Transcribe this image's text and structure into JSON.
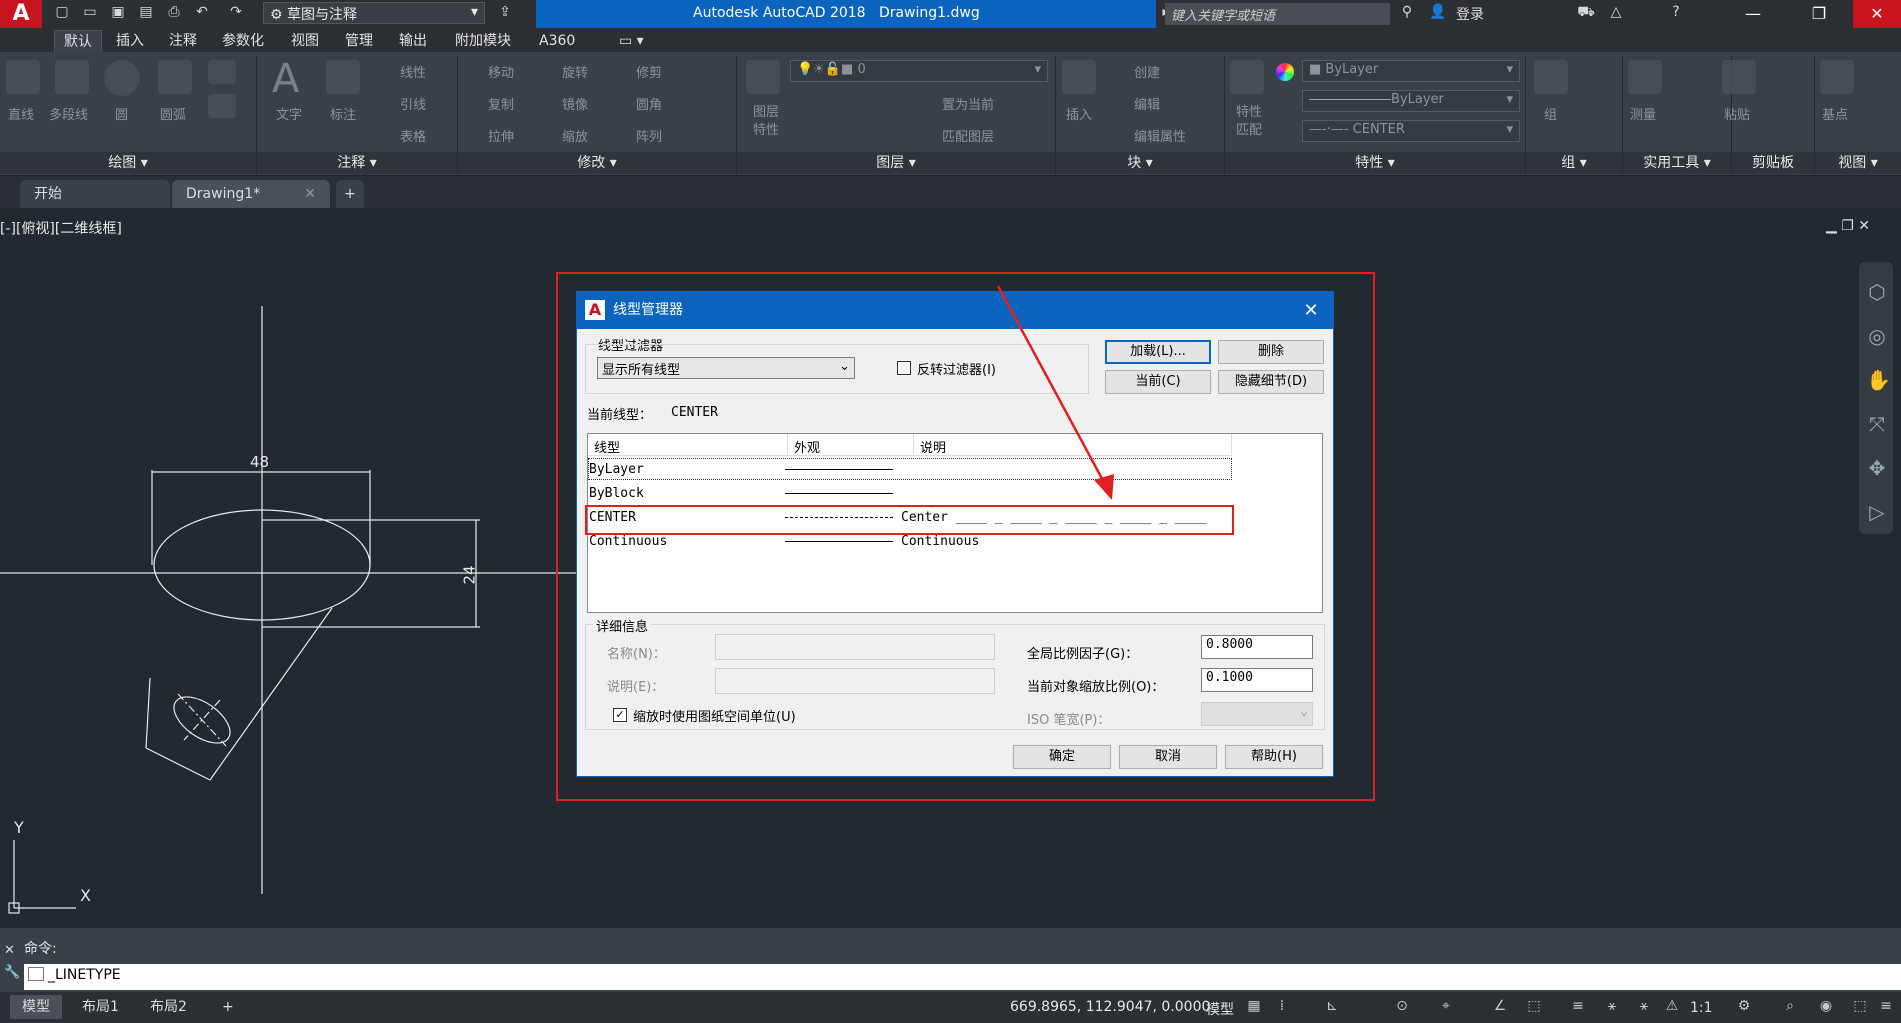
{
  "app": {
    "logo": "A",
    "title": "Autodesk AutoCAD 2018",
    "doc_name": "Drawing1.dwg",
    "workspace": "草图与注释",
    "search_placeholder": "键入关键字或短语",
    "login": "登录"
  },
  "menu_tabs": [
    "默认",
    "插入",
    "注释",
    "参数化",
    "视图",
    "管理",
    "输出",
    "附加模块",
    "A360"
  ],
  "ribbon": {
    "draw": {
      "title": "绘图",
      "items": [
        "直线",
        "多段线",
        "圆",
        "圆弧"
      ]
    },
    "annotate": {
      "title": "注释",
      "items": [
        "文字",
        "标注",
        "线性",
        "引线",
        "表格"
      ]
    },
    "modify": {
      "title": "修改",
      "items": [
        "移动",
        "旋转",
        "修剪",
        "复制",
        "镜像",
        "圆角",
        "拉伸",
        "缩放",
        "阵列"
      ]
    },
    "layers": {
      "title": "图层",
      "items": [
        "图层特性",
        "置为当前",
        "匹配图层"
      ],
      "layer_value": "0"
    },
    "block": {
      "title": "块",
      "items": [
        "插入",
        "创建",
        "编辑",
        "编辑属性"
      ]
    },
    "properties": {
      "title": "特性",
      "items": [
        "特性匹配"
      ],
      "color": "ByLayer",
      "lineweight": "ByLayer",
      "linetype": "CENTER"
    },
    "groups": {
      "title": "组",
      "items": [
        "组"
      ]
    },
    "utilities": {
      "title": "实用工具",
      "items": [
        "测量"
      ]
    },
    "clipboard": {
      "title": "剪贴板",
      "items": [
        "粘贴"
      ]
    },
    "view": {
      "title": "视图",
      "items": [
        "基点"
      ]
    }
  },
  "doc_tabs": [
    "开始",
    "Drawing1*"
  ],
  "viewport_label": "[-][俯视][二维线框]",
  "drawing": {
    "dim_horizontal": "48",
    "dim_vertical": "24",
    "ucs_x": "X",
    "ucs_y": "Y"
  },
  "dialog": {
    "title": "线型管理器",
    "filter_group": "线型过滤器",
    "filter_value": "显示所有线型",
    "invert_filter": "反转过滤器(I)",
    "buttons": {
      "load": "加载(L)...",
      "delete": "删除",
      "current": "当前(C)",
      "hide_details": "隐藏细节(D)",
      "ok": "确定",
      "cancel": "取消",
      "help": "帮助(H)"
    },
    "current_label": "当前线型：",
    "current_value": "CENTER",
    "columns": [
      "线型",
      "外观",
      "说明"
    ],
    "rows": [
      {
        "name": "ByLayer",
        "desc": ""
      },
      {
        "name": "ByBlock",
        "desc": ""
      },
      {
        "name": "CENTER",
        "desc": "Center ____ _ ____ _ ____ _ ____ _ ____"
      },
      {
        "name": "Continuous",
        "desc": "Continuous"
      }
    ],
    "details_group": "详细信息",
    "name_label": "名称(N)：",
    "desc_label": "说明(E)：",
    "paper_space_units": "缩放时使用图纸空间单位(U)",
    "global_scale_label": "全局比例因子(G)：",
    "global_scale_value": "0.8000",
    "current_scale_label": "当前对象缩放比例(O)：",
    "current_scale_value": "0.1000",
    "iso_pen_label": "ISO 笔宽(P)："
  },
  "command": {
    "history": "命令:",
    "input": "_LINETYPE"
  },
  "status": {
    "layout_tabs": [
      "模型",
      "布局1",
      "布局2"
    ],
    "coords": "669.8965, 112.9047, 0.0000",
    "model": "模型",
    "scale": "1:1"
  },
  "colors": {
    "accent_blue": "#0a64bd",
    "highlight_red": "#e02020",
    "logo_red": "#c8141e"
  }
}
